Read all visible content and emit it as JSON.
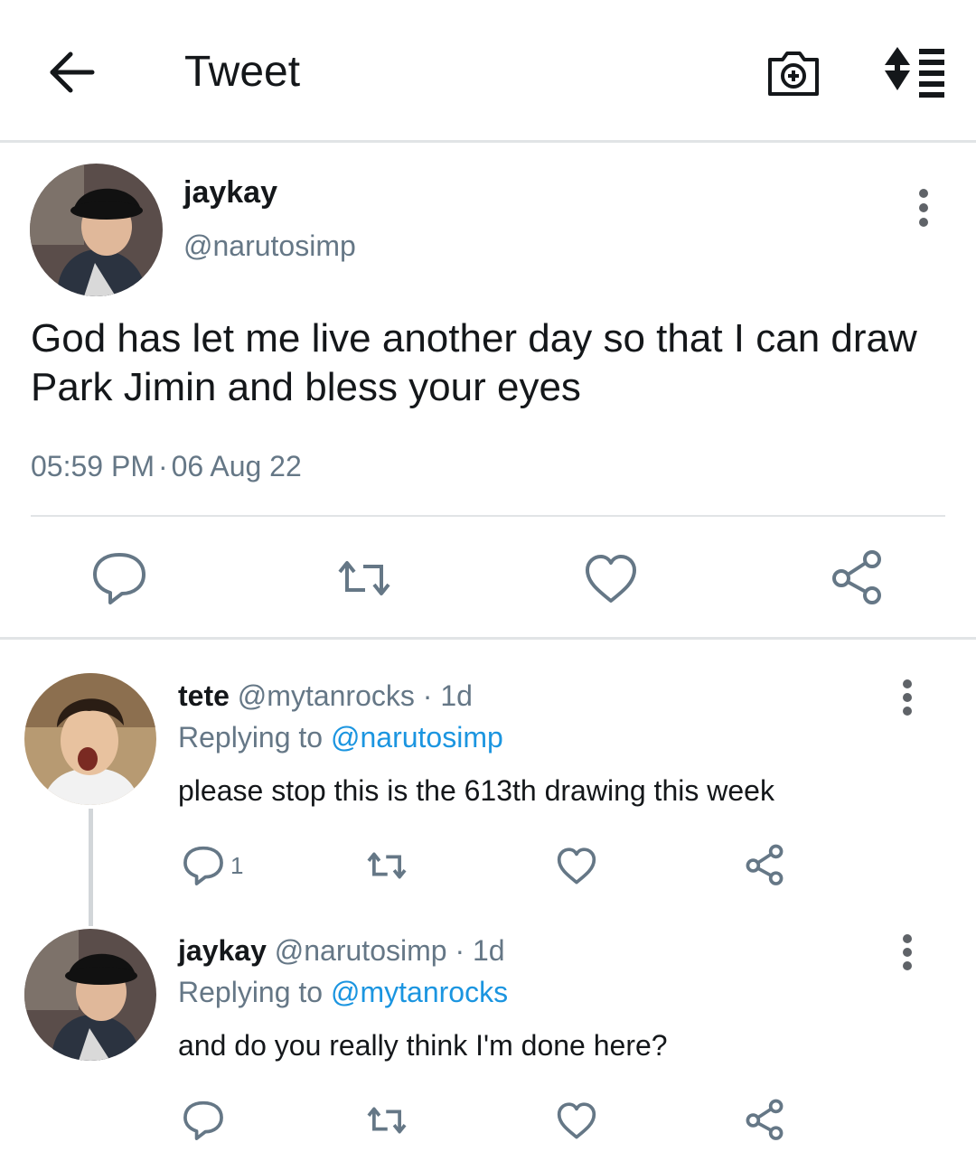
{
  "header": {
    "title": "Tweet",
    "icons": [
      "back-arrow-icon",
      "camera-plus-icon",
      "sort-icon"
    ]
  },
  "tweet": {
    "author_name": "jaykay",
    "author_handle": "@narutosimp",
    "text": "God has let me live another day so that I can draw Park Jimin and bless your eyes",
    "time": "05:59 PM",
    "date": "06 Aug 22"
  },
  "replies": [
    {
      "name": "tete",
      "handle": "@mytanrocks",
      "age": "1d",
      "replying_label": "Replying to",
      "replying_to": "@narutosimp",
      "text": "please stop this is the 613th drawing this week",
      "reply_count": "1"
    },
    {
      "name": "jaykay",
      "handle": "@narutosimp",
      "age": "1d",
      "replying_label": "Replying to",
      "replying_to": "@mytanrocks",
      "text": "and do you really think I'm done here?"
    }
  ],
  "colors": {
    "text": "#14171a",
    "secondary": "#657786",
    "link": "#1b95e0",
    "divider": "#e1e4e6"
  }
}
